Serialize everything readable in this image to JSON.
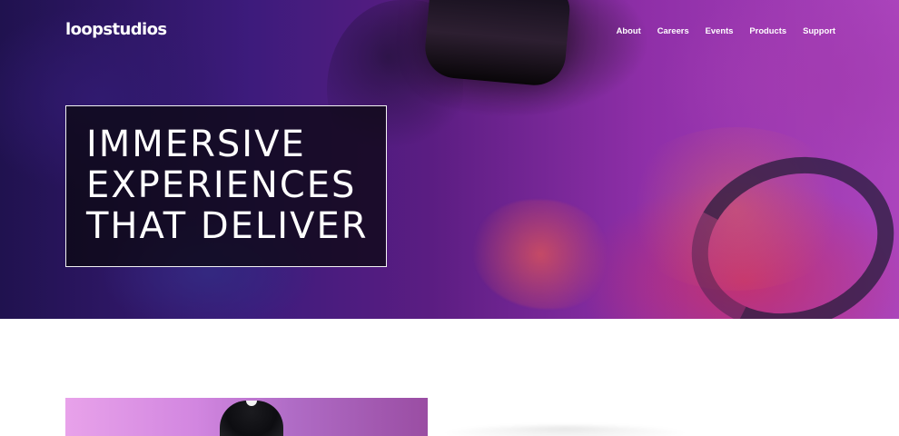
{
  "header": {
    "logo": "loopstudios",
    "nav": [
      {
        "label": "About"
      },
      {
        "label": "Careers"
      },
      {
        "label": "Events"
      },
      {
        "label": "Products"
      },
      {
        "label": "Support"
      }
    ]
  },
  "hero": {
    "title_lines": [
      "IMMERSIVE",
      "EXPERIENCES",
      "THAT DELIVER"
    ]
  },
  "colors": {
    "hero_overlay": "#0a0810",
    "hero_purple": "#5b1d82",
    "hero_magenta": "#ab44bc",
    "feature_pink": "#e8a2ea"
  }
}
